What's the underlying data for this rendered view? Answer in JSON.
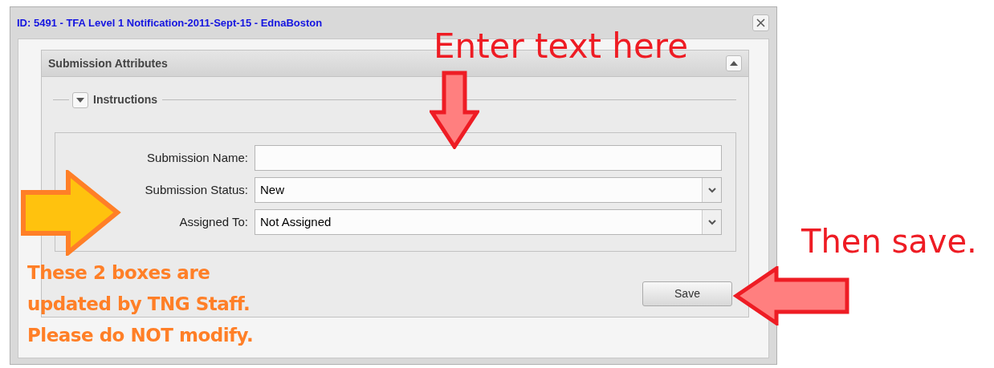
{
  "window": {
    "title": "ID: 5491 - TFA Level 1 Notification-2011-Sept-15 - EdnaBoston"
  },
  "panel": {
    "title": "Submission Attributes",
    "expanded": true
  },
  "instructions": {
    "label": "Instructions",
    "expanded": false
  },
  "fields": [
    {
      "label": "Submission Name:",
      "kind": "text"
    },
    {
      "label": "Submission Status:",
      "kind": "select",
      "value": "New"
    },
    {
      "label": "Assigned To:",
      "kind": "select",
      "value": "Not Assigned"
    }
  ],
  "save_button": "Save",
  "annotations": {
    "enter_note": "Enter text here",
    "staff_note": [
      "These 2 boxes are",
      "updated by TNG Staff.",
      "Please do NOT modify."
    ],
    "save_note": "Then save."
  }
}
